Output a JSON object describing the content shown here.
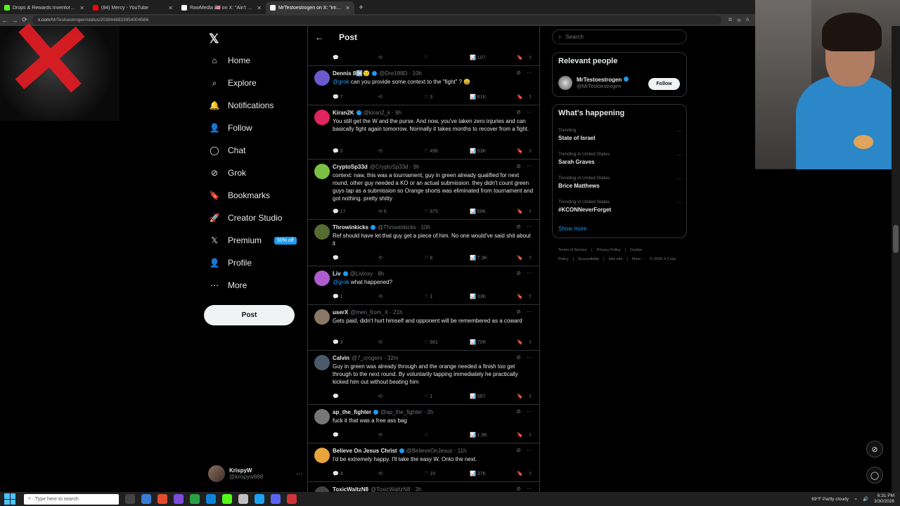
{
  "browser": {
    "tabs": [
      {
        "title": "Drops & Rewards Inventory - Kick",
        "color": "#53fc18",
        "active": false
      },
      {
        "title": "(84) Mercy - YouTube",
        "color": "#ff0000",
        "active": false
      },
      {
        "title": "RawMedia 🇺🇸 on X: \"Ain't no way",
        "color": "#ffffff",
        "active": false
      },
      {
        "title": "MrTestoestrogen on X: \"imagine t",
        "color": "#ffffff",
        "active": true
      }
    ],
    "new_tab": "+",
    "url_host": "x.com",
    "url_path": "/MrTestoestrogen/status/2038448833954004566",
    "nav": {
      "back": "←",
      "forward": "→",
      "reload": "⟳"
    }
  },
  "sidebar": {
    "logo": "𝕏",
    "items": [
      {
        "label": "Home",
        "icon": "⌂"
      },
      {
        "label": "Explore",
        "icon": "⌕"
      },
      {
        "label": "Notifications",
        "icon": "🔔"
      },
      {
        "label": "Follow",
        "icon": "👤"
      },
      {
        "label": "Chat",
        "icon": "◯"
      },
      {
        "label": "Grok",
        "icon": "⊘"
      },
      {
        "label": "Bookmarks",
        "icon": "🔖"
      },
      {
        "label": "Creator Studio",
        "icon": "🚀"
      },
      {
        "label": "Premium",
        "icon": "𝕏",
        "badge": "50% off"
      },
      {
        "label": "Profile",
        "icon": "👤"
      },
      {
        "label": "More",
        "icon": "⋯"
      }
    ],
    "post_button": "Post",
    "account": {
      "name": "KrispyW",
      "handle": "@krispyw888",
      "more": "···"
    }
  },
  "main": {
    "header_back": "←",
    "header_title": "Post",
    "top_partial": {
      "likes": "",
      "views": "107"
    },
    "tweets": [
      {
        "name": "Dennis 8🆗🙂",
        "handle": "@Dre188D · 10h",
        "verified": true,
        "mention": "@grok",
        "text": " can you provide some context to the \"fight\" ? 😄",
        "replies": "7",
        "reposts": "",
        "likes": "3",
        "views": "81K",
        "avatar": "#6a5acd"
      },
      {
        "name": "Kiran2K",
        "handle": "@kiran2_k · 9h",
        "verified": true,
        "mention": "",
        "text": "You still get the W and the purse. And now, you've taken zero injuries and can basically fight again tomorrow. Normally it takes months to recover from a fight.",
        "replies": "3",
        "reposts": "",
        "likes": "496",
        "views": "53K",
        "avatar": "#e0245e"
      },
      {
        "name": "CryptoSp33d",
        "handle": "@CryptoSp33d · 9h",
        "verified": false,
        "mention": "",
        "text": "context: naw, this was a tournament, guy in green already qualified for next round, other guy needed a KO or an actual submission. they didn't count green guys tap as a submission so Orange shorts was eliminated from tournament and got nothing. pretty shitty",
        "replies": "17",
        "reposts": "6",
        "likes": "875",
        "views": "59K",
        "avatar": "#7bc043"
      },
      {
        "name": "Throwinkicks",
        "handle": "@Throwinkicks · 10h",
        "verified": true,
        "mention": "",
        "text": "Ref should have let that guy get a piece of him. No one would've said shit about it",
        "replies": "",
        "reposts": "",
        "likes": "8",
        "views": "7.3K",
        "avatar": "#556b2f"
      },
      {
        "name": "Liv",
        "handle": "@Livloxy · 8h",
        "verified": true,
        "mention": "@grok",
        "text": " what happened?",
        "replies": "1",
        "reposts": "",
        "likes": "1",
        "views": "33K",
        "avatar": "#b05ccf"
      },
      {
        "name": "userX",
        "handle": "@men_from_X · 21h",
        "verified": false,
        "mention": "",
        "text": "Gets paid, didn't hurt himself and opponent will be remembered as a coward",
        "replies": "3",
        "reposts": "",
        "likes": "661",
        "views": "70K",
        "avatar": "#8b7765"
      },
      {
        "name": "Calvin",
        "handle": "@7_crogers · 32m",
        "verified": false,
        "mention": "",
        "text": "Guy in green was already through and the orange needed a finish too get through to the next round. By voluntarily tapping immediately he practically kicked him out without beating him",
        "replies": "",
        "reposts": "",
        "likes": "1",
        "views": "567",
        "avatar": "#4a5a6a"
      },
      {
        "name": "ap_the_fighter",
        "handle": "@ap_the_fighter · 2h",
        "verified": true,
        "mention": "",
        "text": "fuck it that was a free ass bag",
        "replies": "",
        "reposts": "",
        "likes": "",
        "views": "1.9K",
        "avatar": "#777777"
      },
      {
        "name": "Believe On Jesus Christ",
        "handle": "@BelieveOnJesus · 11h",
        "verified": true,
        "mention": "",
        "text": "I'd be extremely happy. I'll take the easy W. Onto the next.",
        "replies": "4",
        "reposts": "",
        "likes": "15",
        "views": "37K",
        "avatar": "#e8a33d"
      },
      {
        "name": "ToxicWaltzN8",
        "handle": "@ToxicWaltzN8 · 3h",
        "verified": false,
        "mention": "",
        "text": "",
        "replies": "",
        "reposts": "",
        "likes": "",
        "views": "",
        "avatar": "#444444"
      }
    ]
  },
  "right": {
    "search_placeholder": "Search",
    "relevant_title": "Relevant people",
    "relevant_user": {
      "name": "MrTestoestrogen",
      "handle": "@MrTestoestrogen"
    },
    "follow_label": "Follow",
    "happening_title": "What's happening",
    "trends": [
      {
        "context": "Trending",
        "title": "State of Israel"
      },
      {
        "context": "Trending in United States",
        "title": "Sarah Graves"
      },
      {
        "context": "Trending in United States",
        "title": "Brice Matthews"
      },
      {
        "context": "Trending in United States",
        "title": "#KCONNeverForget"
      }
    ],
    "show_more": "Show more",
    "footer_links": [
      "Terms of Service",
      "|",
      "Privacy Policy",
      "|",
      "Cookie Policy",
      "|",
      "Accessibility",
      "|",
      "Ads info",
      "|",
      "More ···",
      "© 2026 X Corp."
    ]
  },
  "taskbar": {
    "search_placeholder": "Type here to search",
    "weather": "69°F  Partly cloudy",
    "time": "6:31 PM",
    "date": "3/30/2026"
  }
}
